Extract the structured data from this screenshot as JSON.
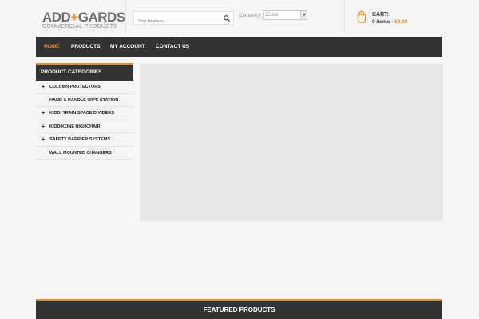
{
  "logo": {
    "main_before": "ADD",
    "main_after": "GARDS",
    "subtitle": "COMMERCIAL PRODUCTS"
  },
  "search": {
    "placeholder": "Your keyword"
  },
  "currency": {
    "label": "Currency:",
    "selected": "Euros"
  },
  "cart": {
    "label": "CART:",
    "items": "0 items",
    "separator": " - ",
    "total": "€0.00"
  },
  "nav": {
    "items": [
      "HOME",
      "PRODUCTS",
      "MY ACCOUNT",
      "CONTACT US"
    ]
  },
  "sidebar": {
    "title": "PRODUCT CATEGORIES",
    "items": [
      {
        "label": "COLUMN PROTECTORS",
        "expand": "+"
      },
      {
        "label": "HAND & HANDLE WIPE STATION",
        "expand": ""
      },
      {
        "label": "KIDDI TRAIN SPACE DIVIDERS",
        "expand": "+"
      },
      {
        "label": "KIDDIKONE HIGHCHAIR",
        "expand": "+"
      },
      {
        "label": "SAFETY BARRIER SYSTEMS",
        "expand": "+"
      },
      {
        "label": "WALL MOUNTED CHANGERS",
        "expand": ""
      }
    ]
  },
  "featured": {
    "title": "FEATURED PRODUCTS"
  },
  "colors": {
    "accent": "#f08c1e",
    "dark": "#333333",
    "background": "#f5f5f5",
    "banner": "#e8e8e8"
  },
  "icons": {
    "search": "search-icon",
    "cart": "shopping-bag-icon",
    "dropdown": "chevron-down-icon",
    "expand": "plus-icon"
  }
}
